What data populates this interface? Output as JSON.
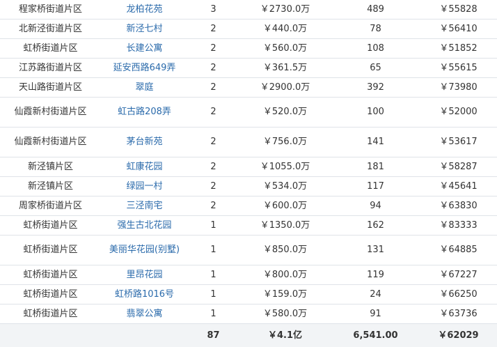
{
  "table": {
    "rows": [
      {
        "area": "程家桥街道片区",
        "community": "龙柏花苑",
        "count": "3",
        "total": "￥2730.0万",
        "units": "489",
        "avg": "￥55828"
      },
      {
        "area": "北新泾街道片区",
        "community": "新泾七村",
        "count": "2",
        "total": "￥440.0万",
        "units": "78",
        "avg": "￥56410"
      },
      {
        "area": "虹桥街道片区",
        "community": "长建公寓",
        "count": "2",
        "total": "￥560.0万",
        "units": "108",
        "avg": "￥51852"
      },
      {
        "area": "江苏路街道片区",
        "community": "延安西路649弄",
        "count": "2",
        "total": "￥361.5万",
        "units": "65",
        "avg": "￥55615"
      },
      {
        "area": "天山路街道片区",
        "community": "翠庭",
        "count": "2",
        "total": "￥2900.0万",
        "units": "392",
        "avg": "￥73980"
      },
      {
        "area": "仙霞新村街道片区",
        "community": "虹古路208弄",
        "count": "2",
        "total": "￥520.0万",
        "units": "100",
        "avg": "￥52000"
      },
      {
        "area": "仙霞新村街道片区",
        "community": "茅台新苑",
        "count": "2",
        "total": "￥756.0万",
        "units": "141",
        "avg": "￥53617"
      },
      {
        "area": "新泾镇片区",
        "community": "虹康花园",
        "count": "2",
        "total": "￥1055.0万",
        "units": "181",
        "avg": "￥58287"
      },
      {
        "area": "新泾镇片区",
        "community": "绿园一村",
        "count": "2",
        "total": "￥534.0万",
        "units": "117",
        "avg": "￥45641"
      },
      {
        "area": "周家桥街道片区",
        "community": "三泾南宅",
        "count": "2",
        "total": "￥600.0万",
        "units": "94",
        "avg": "￥63830"
      },
      {
        "area": "虹桥街道片区",
        "community": "强生古北花园",
        "count": "1",
        "total": "￥1350.0万",
        "units": "162",
        "avg": "￥83333"
      },
      {
        "area": "虹桥街道片区",
        "community": "美丽华花园(别墅)",
        "count": "1",
        "total": "￥850.0万",
        "units": "131",
        "avg": "￥64885"
      },
      {
        "area": "虹桥街道片区",
        "community": "里昂花园",
        "count": "1",
        "total": "￥800.0万",
        "units": "119",
        "avg": "￥67227"
      },
      {
        "area": "虹桥街道片区",
        "community": "虹桥路1016号",
        "count": "1",
        "total": "￥159.0万",
        "units": "24",
        "avg": "￥66250"
      },
      {
        "area": "虹桥街道片区",
        "community": "翡翠公寓",
        "count": "1",
        "total": "￥580.0万",
        "units": "91",
        "avg": "￥63736"
      }
    ],
    "totals": {
      "area": "",
      "community": "",
      "count": "87",
      "total": "￥4.1亿",
      "units": "6,541.00",
      "avg": "￥62029"
    }
  },
  "colors": {
    "link": "#2a6aab",
    "text": "#333333",
    "border": "#dfe3e8",
    "total_bg": "#f2f4f6"
  }
}
